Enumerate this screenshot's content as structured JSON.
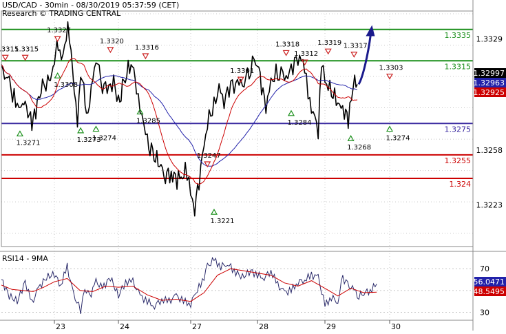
{
  "header": {
    "title": "USD/CAD - 30min - 08/30/2019 05:37:59 (CET)",
    "subtitle": "Research © TRADING CENTRAL"
  },
  "indicator": {
    "label": "RSI14 - 9MA"
  },
  "colors": {
    "background": "#ffffff",
    "price_line": "#000000",
    "ma_fast": "#cc0000",
    "ma_slow": "#2222aa",
    "resistance": "#1a8f1a",
    "pivot": "#3a2aa0",
    "support": "#cc0000",
    "forecast_arrow": "#1a1a8c",
    "grid": "#c8c8c8",
    "last_price_tag": "#000000",
    "slow_tag": "#2222aa",
    "fast_tag": "#cc0000"
  },
  "chart_data": [
    {
      "type": "line",
      "panel": "price",
      "x_tick_labels": [
        "23",
        "24",
        "27",
        "28",
        "29",
        "30"
      ],
      "ylim": [
        1.32,
        1.3345
      ],
      "y_tick_labels": [
        1.3329,
        1.3258,
        1.3223
      ],
      "grid": true,
      "level_lines": [
        {
          "value": 1.3335,
          "label": "1.3335",
          "kind": "resistance"
        },
        {
          "value": 1.3315,
          "label": "1.3315",
          "kind": "resistance"
        },
        {
          "value": 1.3275,
          "label": "1.3275",
          "kind": "pivot"
        },
        {
          "value": 1.3255,
          "label": "1.3255",
          "kind": "support"
        },
        {
          "value": 1.324,
          "label": "1.324",
          "kind": "support"
        }
      ],
      "price_tags": [
        {
          "value": 1.32997,
          "label": "1.32997",
          "kind": "last"
        },
        {
          "value": 1.32963,
          "label": "1.32963",
          "kind": "slow_ma"
        },
        {
          "value": 1.32925,
          "label": "1.32925",
          "kind": "fast_ma"
        }
      ],
      "price_path": [
        [
          0.0,
          1.331
        ],
        [
          0.3,
          1.33
        ],
        [
          0.6,
          1.3285
        ],
        [
          0.8,
          1.329
        ],
        [
          1.0,
          1.3284
        ],
        [
          1.15,
          1.3274
        ],
        [
          1.35,
          1.3288
        ],
        [
          1.55,
          1.3298
        ],
        [
          1.75,
          1.3302
        ],
        [
          1.9,
          1.3308
        ],
        [
          2.0,
          1.3318
        ],
        [
          2.12,
          1.3326
        ],
        [
          2.22,
          1.3315
        ],
        [
          2.32,
          1.332
        ],
        [
          2.42,
          1.3335
        ],
        [
          2.52,
          1.3322
        ],
        [
          2.62,
          1.33
        ],
        [
          2.72,
          1.3278
        ],
        [
          2.82,
          1.3305
        ],
        [
          2.92,
          1.3296
        ],
        [
          3.0,
          1.3276
        ],
        [
          3.15,
          1.3298
        ],
        [
          3.3,
          1.3318
        ],
        [
          3.5,
          1.33
        ],
        [
          3.65,
          1.3296
        ],
        [
          3.85,
          1.3302
        ],
        [
          4.0,
          1.3287
        ],
        [
          4.15,
          1.33
        ],
        [
          4.35,
          1.3316
        ],
        [
          4.5,
          1.33
        ],
        [
          4.6,
          1.3285
        ],
        [
          4.7,
          1.3272
        ],
        [
          4.8,
          1.3262
        ],
        [
          4.95,
          1.3255
        ],
        [
          5.1,
          1.325
        ],
        [
          5.3,
          1.3243
        ],
        [
          5.5,
          1.3242
        ],
        [
          5.7,
          1.3238
        ],
        [
          5.85,
          1.3244
        ],
        [
          5.95,
          1.3236
        ],
        [
          6.05,
          1.3228
        ],
        [
          6.12,
          1.3222
        ],
        [
          6.25,
          1.3238
        ],
        [
          6.4,
          1.326
        ],
        [
          6.55,
          1.3278
        ],
        [
          6.7,
          1.3286
        ],
        [
          6.85,
          1.33
        ],
        [
          7.0,
          1.329
        ],
        [
          7.15,
          1.3298
        ],
        [
          7.35,
          1.3302
        ],
        [
          7.5,
          1.3298
        ],
        [
          7.7,
          1.3304
        ],
        [
          7.9,
          1.3314
        ],
        [
          8.0,
          1.3316
        ],
        [
          8.12,
          1.33
        ],
        [
          8.25,
          1.3284
        ],
        [
          8.4,
          1.33
        ],
        [
          8.55,
          1.3306
        ],
        [
          8.75,
          1.3305
        ],
        [
          8.9,
          1.3307
        ],
        [
          9.05,
          1.3313
        ],
        [
          9.2,
          1.3316
        ],
        [
          9.35,
          1.3313
        ],
        [
          9.45,
          1.33
        ],
        [
          9.55,
          1.3287
        ],
        [
          9.7,
          1.3282
        ],
        [
          9.8,
          1.3272
        ],
        [
          9.9,
          1.3316
        ],
        [
          10.0,
          1.33
        ],
        [
          10.15,
          1.3296
        ],
        [
          10.3,
          1.3292
        ],
        [
          10.45,
          1.3288
        ],
        [
          10.6,
          1.3284
        ],
        [
          10.72,
          1.3278
        ],
        [
          10.82,
          1.329
        ],
        [
          10.92,
          1.33
        ],
        [
          11.0,
          1.33
        ]
      ],
      "forecast_arrow": {
        "from": [
          11.0,
          1.33
        ],
        "to": [
          11.2,
          1.3336
        ]
      },
      "annotations": [
        {
          "label": "1.3315",
          "x": 0.15,
          "y": 1.3315,
          "kind": "top"
        },
        {
          "label": "1.3315",
          "x": 0.9,
          "y": 1.3315,
          "kind": "top"
        },
        {
          "label": "1.3327",
          "x": 2.1,
          "y": 1.3327,
          "kind": "top"
        },
        {
          "label": "1.3308",
          "x": 2.1,
          "y": 1.3308,
          "kind": "bottom"
        },
        {
          "label": "1.3271",
          "x": 0.7,
          "y": 1.3271,
          "kind": "bottom"
        },
        {
          "label": "1.3320",
          "x": 3.75,
          "y": 1.332,
          "kind": "top"
        },
        {
          "label": "1.3273",
          "x": 2.82,
          "y": 1.3273,
          "kind": "bottom"
        },
        {
          "label": "1.3274",
          "x": 3.3,
          "y": 1.3274,
          "kind": "bottom"
        },
        {
          "label": "1.3316",
          "x": 4.75,
          "y": 1.3316,
          "kind": "top"
        },
        {
          "label": "1.3285",
          "x": 4.6,
          "y": 1.3285,
          "kind": "bottom"
        },
        {
          "label": "1.3247",
          "x": 6.5,
          "y": 1.3247,
          "kind": "top"
        },
        {
          "label": "1.3221",
          "x": 6.7,
          "y": 1.3221,
          "kind": "bottom"
        },
        {
          "label": "1.3301",
          "x": 7.5,
          "y": 1.3301,
          "kind": "top"
        },
        {
          "label": "1.3318",
          "x": 8.85,
          "y": 1.3318,
          "kind": "top"
        },
        {
          "label": "1.3312",
          "x": 9.4,
          "y": 1.3312,
          "kind": "top"
        },
        {
          "label": "1.3284",
          "x": 9.0,
          "y": 1.3284,
          "kind": "bottom"
        },
        {
          "label": "1.3319",
          "x": 10.1,
          "y": 1.3319,
          "kind": "top"
        },
        {
          "label": "1.3317",
          "x": 10.9,
          "y": 1.3317,
          "kind": "top"
        },
        {
          "label": "1.3268",
          "x": 10.8,
          "y": 1.3268,
          "kind": "bottom"
        },
        {
          "label": "1.3303",
          "x": 12.0,
          "y": 1.3303,
          "kind": "top"
        },
        {
          "label": "1.3274",
          "x": 12.0,
          "y": 1.3274,
          "kind": "bottom"
        }
      ]
    },
    {
      "type": "line",
      "panel": "indicator",
      "ylim": [
        24,
        84
      ],
      "y_tick_labels": [
        70,
        30
      ],
      "grid": true,
      "reference_lines": [
        70,
        50,
        30
      ],
      "value_tags": [
        {
          "value": 56.0471,
          "label": "56.0471",
          "kind": "rsi"
        },
        {
          "value": 48.5495,
          "label": "48.5495",
          "kind": "ma"
        }
      ],
      "series": [
        {
          "kind": "rsi",
          "points": [
            [
              0.0,
              60
            ],
            [
              0.3,
              45
            ],
            [
              0.6,
              40
            ],
            [
              0.9,
              58
            ],
            [
              1.15,
              38
            ],
            [
              1.4,
              52
            ],
            [
              1.7,
              62
            ],
            [
              2.0,
              65
            ],
            [
              2.2,
              55
            ],
            [
              2.4,
              72
            ],
            [
              2.55,
              52
            ],
            [
              2.7,
              40
            ],
            [
              2.82,
              32
            ],
            [
              2.95,
              52
            ],
            [
              3.1,
              44
            ],
            [
              3.3,
              58
            ],
            [
              3.5,
              52
            ],
            [
              3.75,
              62
            ],
            [
              4.0,
              45
            ],
            [
              4.2,
              58
            ],
            [
              4.4,
              58
            ],
            [
              4.6,
              45
            ],
            [
              4.8,
              40
            ],
            [
              5.0,
              36
            ],
            [
              5.2,
              42
            ],
            [
              5.4,
              40
            ],
            [
              5.6,
              45
            ],
            [
              5.8,
              40
            ],
            [
              6.0,
              38
            ],
            [
              6.15,
              48
            ],
            [
              6.35,
              58
            ],
            [
              6.5,
              72
            ],
            [
              6.7,
              78
            ],
            [
              6.9,
              72
            ],
            [
              7.1,
              75
            ],
            [
              7.3,
              68
            ],
            [
              7.55,
              62
            ],
            [
              7.8,
              68
            ],
            [
              8.0,
              64
            ],
            [
              8.2,
              62
            ],
            [
              8.4,
              68
            ],
            [
              8.6,
              55
            ],
            [
              8.8,
              48
            ],
            [
              9.0,
              50
            ],
            [
              9.2,
              58
            ],
            [
              9.4,
              60
            ],
            [
              9.6,
              64
            ],
            [
              9.8,
              62
            ],
            [
              10.0,
              36
            ],
            [
              10.2,
              44
            ],
            [
              10.4,
              40
            ],
            [
              10.55,
              62
            ],
            [
              10.7,
              55
            ],
            [
              10.9,
              50
            ],
            [
              11.05,
              45
            ],
            [
              11.2,
              48
            ],
            [
              11.4,
              50
            ],
            [
              11.6,
              56
            ]
          ]
        },
        {
          "kind": "ma",
          "points": [
            [
              0.0,
              55
            ],
            [
              0.4,
              51
            ],
            [
              0.8,
              50
            ],
            [
              1.2,
              49
            ],
            [
              1.6,
              53
            ],
            [
              2.0,
              58
            ],
            [
              2.4,
              61
            ],
            [
              2.8,
              50
            ],
            [
              3.2,
              49
            ],
            [
              3.6,
              54
            ],
            [
              4.0,
              53
            ],
            [
              4.4,
              54
            ],
            [
              4.8,
              46
            ],
            [
              5.2,
              41
            ],
            [
              5.6,
              42
            ],
            [
              6.0,
              40
            ],
            [
              6.4,
              48
            ],
            [
              6.8,
              64
            ],
            [
              7.2,
              70
            ],
            [
              7.6,
              68
            ],
            [
              8.0,
              66
            ],
            [
              8.4,
              64
            ],
            [
              8.8,
              57
            ],
            [
              9.2,
              54
            ],
            [
              9.6,
              59
            ],
            [
              10.0,
              52
            ],
            [
              10.4,
              45
            ],
            [
              10.8,
              52
            ],
            [
              11.2,
              48
            ],
            [
              11.6,
              48.5
            ]
          ]
        }
      ]
    }
  ]
}
